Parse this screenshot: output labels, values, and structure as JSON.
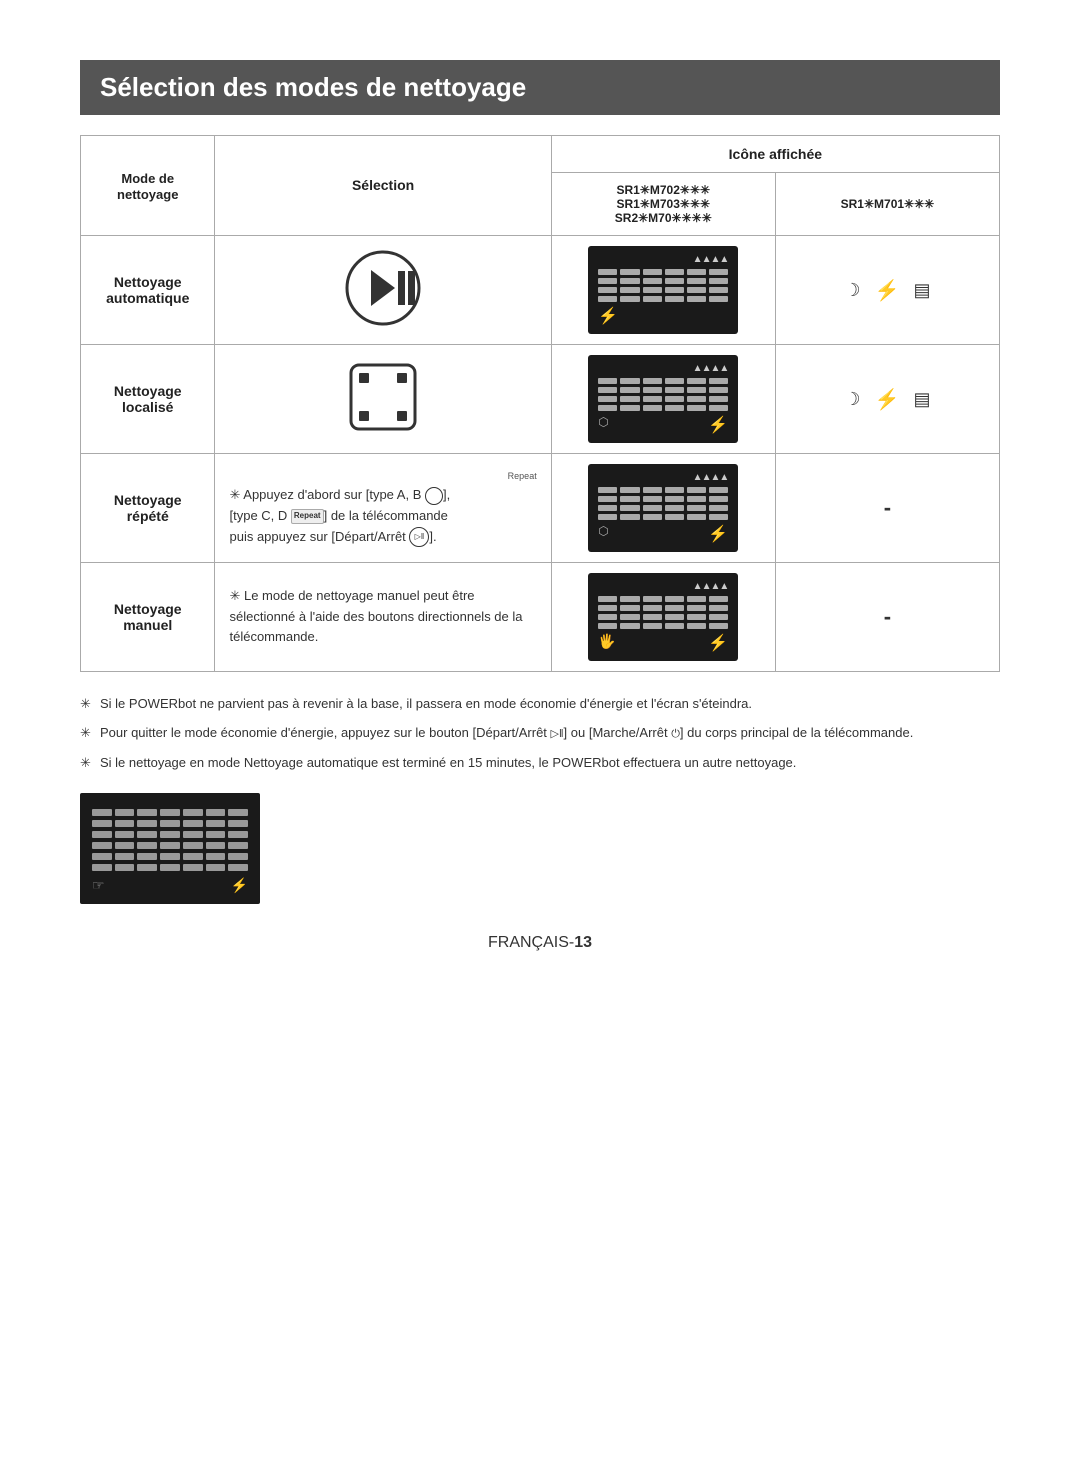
{
  "page": {
    "title": "Sélection des modes de nettoyage",
    "language_label": "FRANÇAIS-",
    "page_number": "13"
  },
  "table": {
    "header": {
      "col1": "Mode de\nnettoyage",
      "col2": "Sélection",
      "icone_affichee": "Icône affichée",
      "model_702": "SR1✳M702✳✳✳\nSR1✳M703✳✳✳\nSR2✳M70✳✳✳✳",
      "model_701": "SR1✳M701✳✳✳"
    },
    "rows": [
      {
        "mode": "Nettoyage\nautomatique",
        "selection_type": "play_pause",
        "has_702": true,
        "has_701": true
      },
      {
        "mode": "Nettoyage\nlocalisé",
        "selection_type": "spot",
        "has_702": true,
        "has_701": true
      },
      {
        "mode": "Nettoyage\nrépété",
        "selection_type": "repeat_text",
        "selection_text_line1": "✳ Appuyez d'abord sur [type A, B",
        "selection_text_line2": "[type C, D",
        "selection_text_repeat": "Repeat",
        "selection_text_line3": "] de la télécommande",
        "selection_text_line4": "puis appuyez sur [Départ/Arrêt",
        "has_702": true,
        "has_701": false,
        "dash": "-"
      },
      {
        "mode": "Nettoyage\nmanuel",
        "selection_type": "manual_text",
        "selection_text": "✳ Le mode de nettoyage manuel peut être sélectionné à l'aide des boutons directionnels de la télécommande.",
        "has_702": true,
        "has_701": false,
        "dash": "-"
      }
    ]
  },
  "notes": [
    "Si le POWERbot ne parvient pas à revenir à la base, il passera en mode économie d'énergie et l'écran s'éteindra.",
    "Pour quitter le mode économie d'énergie, appuyez sur le bouton [Départ/Arrêt ▷‖] ou [Marche/Arrêt ⏻] du corps principal de la télécommande.",
    "Si le nettoyage en mode Nettoyage automatique est terminé en 15 minutes, le POWERbot effectuera un autre nettoyage."
  ]
}
